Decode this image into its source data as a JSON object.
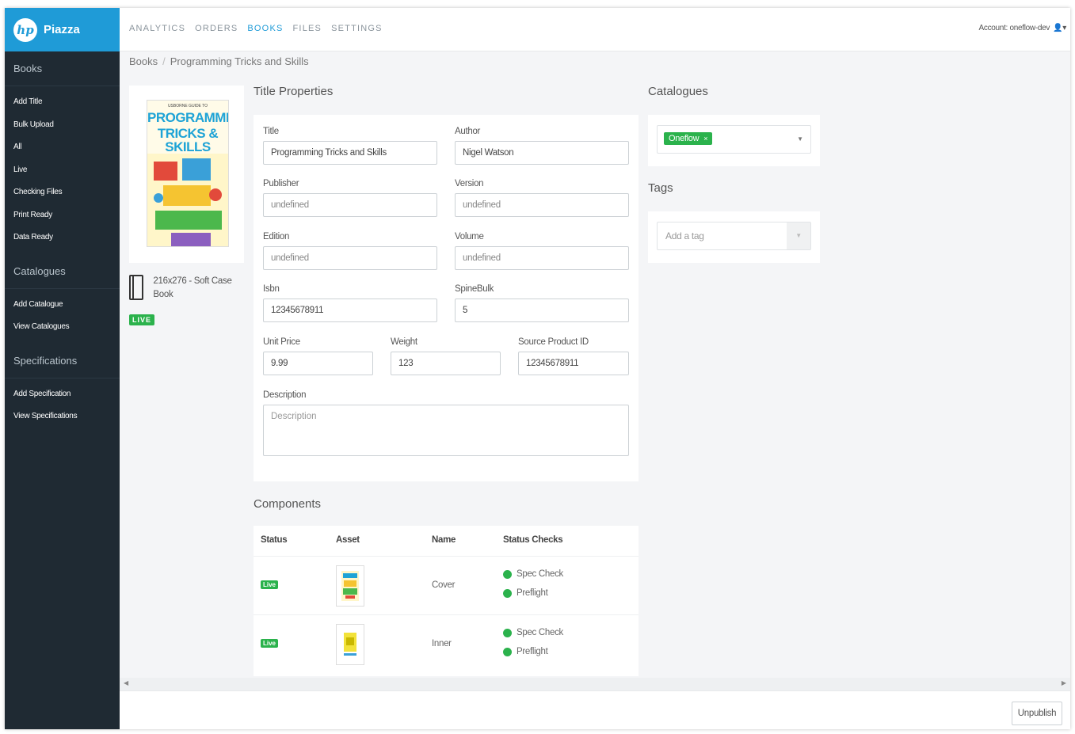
{
  "brand": {
    "name": "Piazza",
    "logo_text": "hp"
  },
  "nav": {
    "items": [
      {
        "label": "ANALYTICS"
      },
      {
        "label": "ORDERS"
      },
      {
        "label": "BOOKS"
      },
      {
        "label": "FILES"
      },
      {
        "label": "SETTINGS"
      }
    ],
    "active": "BOOKS"
  },
  "account": {
    "label": "Account: oneflow-dev",
    "icon": "user-icon"
  },
  "sidebar": {
    "sections": [
      {
        "title": "Books",
        "items": [
          "Add Title",
          "Bulk Upload",
          "All",
          "Live",
          "Checking Files",
          "Print Ready",
          "Data Ready"
        ]
      },
      {
        "title": "Catalogues",
        "items": [
          "Add Catalogue",
          "View Catalogues"
        ]
      },
      {
        "title": "Specifications",
        "items": [
          "Add Specification",
          "View Specifications"
        ]
      }
    ]
  },
  "breadcrumb": {
    "root": "Books",
    "separator": "/",
    "current": "Programming Tricks and Skills"
  },
  "cover": {
    "small_text": "USBORNE GUIDE TO",
    "title_line1": "PROGRAMMING",
    "title_line2": "TRICKS & SKILLS"
  },
  "book_meta": {
    "spec": "216x276 - Soft Case Book",
    "status": "LIVE"
  },
  "title_properties": {
    "heading": "Title Properties",
    "title": {
      "label": "Title",
      "value": "Programming Tricks and Skills"
    },
    "author": {
      "label": "Author",
      "value": "Nigel Watson"
    },
    "publisher": {
      "label": "Publisher",
      "value": "undefined"
    },
    "version": {
      "label": "Version",
      "value": "undefined"
    },
    "edition": {
      "label": "Edition",
      "value": "undefined"
    },
    "volume": {
      "label": "Volume",
      "value": "undefined"
    },
    "isbn": {
      "label": "Isbn",
      "value": "12345678911"
    },
    "spinebulk": {
      "label": "SpineBulk",
      "value": "5"
    },
    "unit_price": {
      "label": "Unit Price",
      "value": "9.99"
    },
    "weight": {
      "label": "Weight",
      "value": "123"
    },
    "source_product_id": {
      "label": "Source Product ID",
      "value": "12345678911"
    },
    "description": {
      "label": "Description",
      "placeholder": "Description"
    }
  },
  "components": {
    "heading": "Components",
    "columns": [
      "Status",
      "Asset",
      "Name",
      "Status Checks"
    ],
    "rows": [
      {
        "status": "Live",
        "name": "Cover",
        "checks": [
          "Spec Check",
          "Preflight"
        ]
      },
      {
        "status": "Live",
        "name": "Inner",
        "checks": [
          "Spec Check",
          "Preflight"
        ]
      }
    ]
  },
  "catalogues": {
    "heading": "Catalogues",
    "selected": "Oneflow",
    "remove_glyph": "×"
  },
  "tags": {
    "heading": "Tags",
    "placeholder": "Add a tag"
  },
  "footer": {
    "unpublish_label": "Unpublish"
  },
  "colors": {
    "brand": "#1f9bd7",
    "sidebar": "#1f2a33",
    "live": "#2bb24c"
  }
}
